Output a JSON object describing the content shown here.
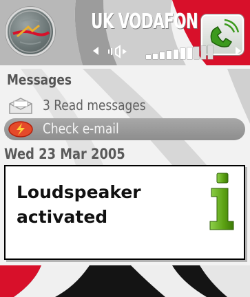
{
  "status": {
    "operator_name": "UK VODAFON",
    "operator_logo_icon": "vodafone-globe-logo-icon",
    "active_call_icon": "phone-handset-icon",
    "volume_icon": "speaker-volume-icon",
    "volume_level": 0.7
  },
  "main": {
    "header": "Messages",
    "items": [
      {
        "label": "3 Read messages",
        "icon": "envelope-icon",
        "selected": false
      },
      {
        "label": "Check e-mail",
        "icon": "email-lightning-icon",
        "selected": true
      }
    ],
    "date": "Wed 23 Mar 2005"
  },
  "note": {
    "text": "Loudspeaker\nactivated",
    "icon": "info-i-icon"
  },
  "theme": {
    "accent_red": "#d8102a",
    "highlight_gray": "#9a9a9a",
    "text_gray": "#606060",
    "note_border": "#000000",
    "info_green": "#5aa012"
  }
}
